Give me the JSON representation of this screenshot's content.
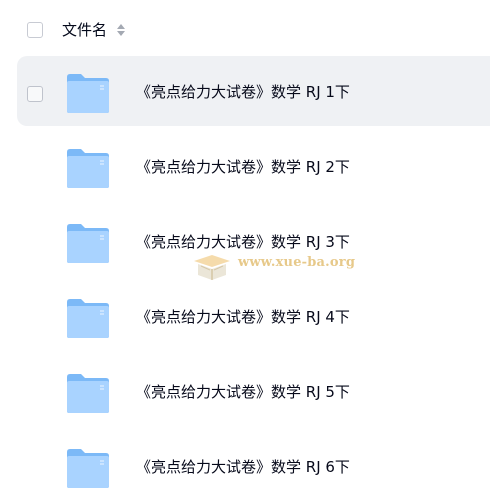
{
  "header": {
    "column_label": "文件名"
  },
  "files": [
    {
      "name": "《亮点给力大试卷》数学 RJ 1下",
      "hovered": true
    },
    {
      "name": "《亮点给力大试卷》数学 RJ 2下",
      "hovered": false
    },
    {
      "name": "《亮点给力大试卷》数学 RJ 3下",
      "hovered": false
    },
    {
      "name": "《亮点给力大试卷》数学 RJ 4下",
      "hovered": false
    },
    {
      "name": "《亮点给力大试卷》数学 RJ 5下",
      "hovered": false
    },
    {
      "name": "《亮点给力大试卷》数学 RJ 6下",
      "hovered": false
    }
  ],
  "watermark": {
    "text": "www.xue-ba.org"
  },
  "icons": {
    "folder": "folder-icon",
    "sort": "sort-icon",
    "checkbox": "checkbox-icon"
  },
  "colors": {
    "hover_row": "#eff1f4",
    "folder_light": "#a9d3ff",
    "folder_dark": "#7cb9f7",
    "text": "#03081a",
    "watermark": "#e7c98a"
  }
}
